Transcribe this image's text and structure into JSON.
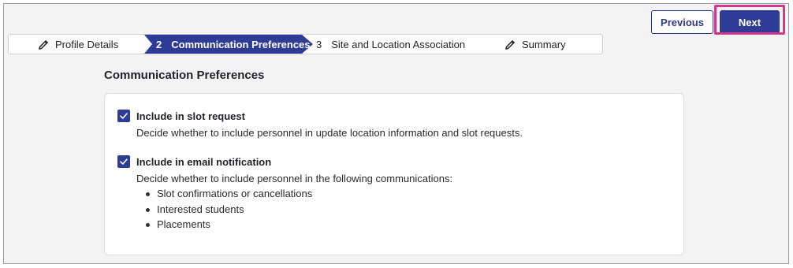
{
  "toolbar": {
    "previous_label": "Previous",
    "next_label": "Next"
  },
  "stepper": {
    "steps": [
      {
        "label": "Profile Details",
        "icon": "pencil-icon",
        "state": "edit"
      },
      {
        "number": "2",
        "label": "Communication Preferences",
        "state": "active"
      },
      {
        "number": "3",
        "label": "Site and Location Association",
        "state": "upcoming"
      },
      {
        "label": "Summary",
        "icon": "pencil-icon",
        "state": "edit"
      }
    ]
  },
  "section": {
    "title": "Communication Preferences"
  },
  "options": [
    {
      "label": "Include in slot request",
      "checked": true,
      "description": "Decide whether to include personnel in update location information and slot requests."
    },
    {
      "label": "Include in email notification",
      "checked": true,
      "description": "Decide whether to include personnel in the following communications:",
      "bullets": [
        "Slot confirmations or cancellations",
        "Interested students",
        "Placements"
      ]
    }
  ],
  "colors": {
    "accent": "#2e3c97",
    "highlight": "#d2378a",
    "background": "#f3f3f3"
  }
}
